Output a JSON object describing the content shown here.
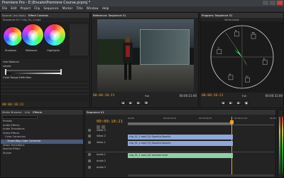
{
  "window": {
    "title": "Premiere Pro - E:\\Envato\\Premiere Course.prproj *"
  },
  "menu": [
    "File",
    "Edit",
    "Project",
    "Clip",
    "Sequence",
    "Marker",
    "Title",
    "Window",
    "Help"
  ],
  "effect_controls": {
    "tabs": [
      "Source: (no clips)",
      "Effect Controls"
    ],
    "clip_label": "Sequence 01 * clip_01_1.mp4",
    "wheels": [
      "Shadows",
      "Midtones",
      "Highlights"
    ],
    "hue_balance_label": "Hue Balance",
    "levels_label": "Levels",
    "color_range_label": "Color Range Definition",
    "timecode": "00:00:18:21"
  },
  "reference_monitor": {
    "tab": "Reference: Sequence 01",
    "timecode_left": "00:00:18:21",
    "zoom": "Full",
    "timecode_right": "00:00:21:00"
  },
  "program_monitor": {
    "tab": "Program: Sequence 01",
    "scope_label": "Vectorscope",
    "timecode_left": "00:00:18:21",
    "zoom": "Full",
    "timecode_right": "00:00:31:00"
  },
  "effects_panel": {
    "tabs": [
      "Media Browser",
      "Info",
      "Effects"
    ],
    "items": [
      "Presets",
      "Audio Effects",
      "Audio Transitions",
      "Video Effects",
      "Color Correction",
      "Three-Way Color Corrector",
      "Video Transitions",
      "Special Effect",
      "Stylize"
    ],
    "selected_index": 5
  },
  "timeline": {
    "tab": "Sequence 01",
    "timecode": "00:00:18:21",
    "ruler": [
      "00:00",
      "00:00:04:23",
      "00:00:09:23",
      "00:00:14:23",
      "00:00:19:23"
    ],
    "tracks": [
      "Video 3",
      "Video 2",
      "Video 1",
      "Audio 1",
      "Audio 2",
      "Audio 3"
    ],
    "clips": {
      "video2": "clip_01_1.mp4 [V]  Opacity:Opacity",
      "video1": "clip_01_1.mp4 [V]  Opacity:Opacity",
      "audio1": "clip_01_1.mp4 [A]  Volume:Level"
    }
  },
  "colors": {
    "accent": "#f0a42d",
    "clip_video": "#8fa8d8",
    "clip_audio": "#8fd0a8",
    "selection": "#4a5a7a"
  },
  "vectorscope": {
    "targets": [
      "R",
      "Mg",
      "B",
      "Cy",
      "G",
      "Yl"
    ]
  }
}
